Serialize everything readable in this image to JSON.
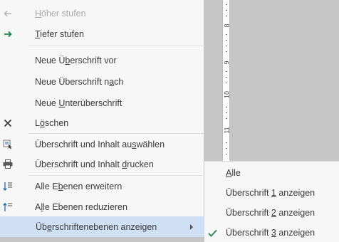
{
  "menu": {
    "items": [
      {
        "id": "promote",
        "before": "",
        "accel": "H",
        "after": "öher stufen",
        "icon": "left-arrow-icon",
        "disabled": true
      },
      {
        "id": "demote",
        "before": "",
        "accel": "T",
        "after": "iefer stufen",
        "icon": "right-arrow-icon",
        "disabled": false
      },
      {
        "id": "new-heading-before",
        "before": "Neue Ü",
        "accel": "b",
        "after": "erschrift vor",
        "icon": "",
        "disabled": false
      },
      {
        "id": "new-heading-after",
        "before": "Neue Überschrift n",
        "accel": "a",
        "after": "ch",
        "icon": "",
        "disabled": false
      },
      {
        "id": "new-subheading",
        "before": "Neue ",
        "accel": "U",
        "after": "nterüberschrift",
        "icon": "",
        "disabled": false
      },
      {
        "id": "delete",
        "before": "L",
        "accel": "ö",
        "after": "schen",
        "icon": "delete-x-icon",
        "disabled": false
      },
      {
        "id": "select-heading-content",
        "before": "Überschrift und Inhalt au",
        "accel": "s",
        "after": "wählen",
        "icon": "select-icon",
        "disabled": false
      },
      {
        "id": "print-heading-content",
        "before": "Überschrift und Inhalt ",
        "accel": "d",
        "after": "rucken",
        "icon": "print-icon",
        "disabled": false
      },
      {
        "id": "expand-all-levels",
        "before": "Alle E",
        "accel": "b",
        "after": "enen erweitern",
        "icon": "expand-levels-icon",
        "disabled": false
      },
      {
        "id": "collapse-all-levels",
        "before": "A",
        "accel": "l",
        "after": "le Ebenen reduzieren",
        "icon": "collapse-levels-icon",
        "disabled": false
      },
      {
        "id": "show-heading-levels",
        "before": "Üb",
        "accel": "e",
        "after": "rschriftenebenen anzeigen",
        "icon": "",
        "disabled": false
      }
    ]
  },
  "submenu": {
    "items": [
      {
        "id": "all",
        "before": "",
        "accel": "A",
        "after": "lle",
        "checked": false
      },
      {
        "id": "level-1",
        "before": "Überschrift ",
        "accel": "1",
        "after": " anzeigen",
        "checked": false
      },
      {
        "id": "level-2",
        "before": "Überschrift ",
        "accel": "2",
        "after": " anzeigen",
        "checked": false
      },
      {
        "id": "level-3",
        "before": "Überschrift ",
        "accel": "3",
        "after": " anzeigen",
        "checked": true
      }
    ]
  },
  "ruler": {
    "numbers": [
      "8",
      "9",
      "10",
      "11"
    ]
  },
  "colors": {
    "accent_arrow": "#1b8a4a",
    "hover": "#cfe0f4",
    "check": "#2e8b57"
  }
}
